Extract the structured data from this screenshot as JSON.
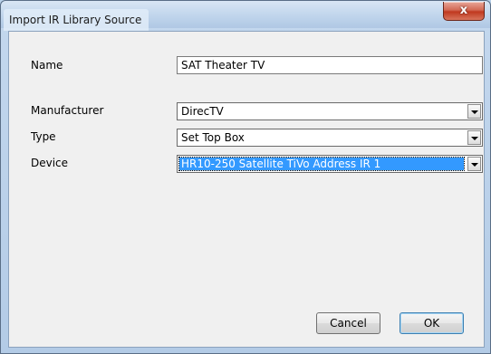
{
  "window": {
    "title": "Import IR Library Source",
    "close_label": "x"
  },
  "form": {
    "name_label": "Name",
    "name_value": "SAT Theater TV",
    "manufacturer_label": "Manufacturer",
    "manufacturer_value": "DirecTV",
    "type_label": "Type",
    "type_value": "Set Top Box",
    "device_label": "Device",
    "device_value": "HR10-250 Satellite TiVo Address IR 1"
  },
  "buttons": {
    "cancel_label": "Cancel",
    "ok_label": "OK"
  },
  "colors": {
    "selection": "#3399ff",
    "client_background": "#f0f0f0"
  }
}
